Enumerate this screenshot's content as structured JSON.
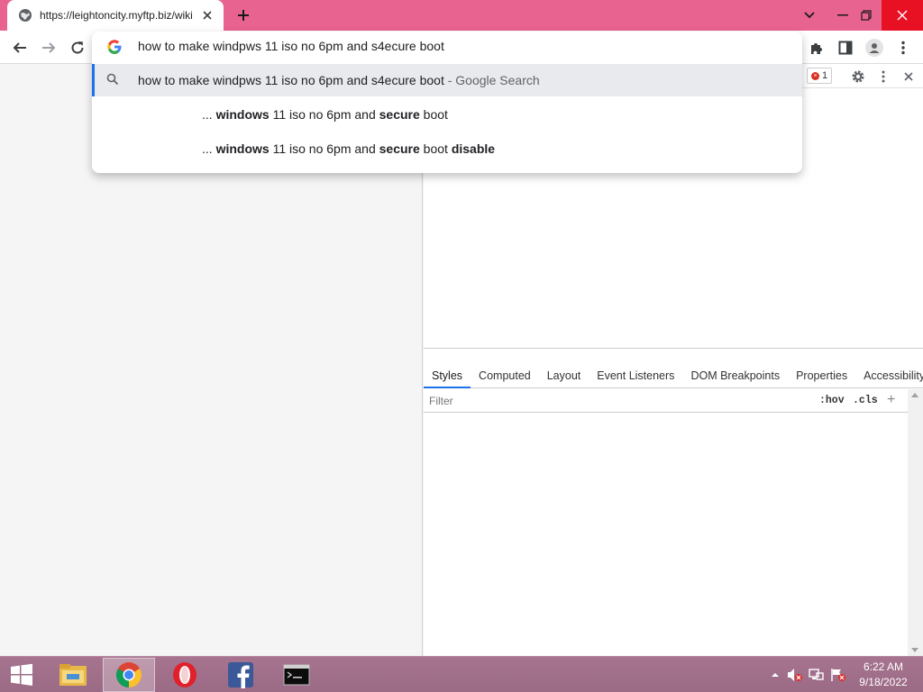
{
  "browser": {
    "tab": {
      "title": "https://leightoncity.myftp.biz/wiki",
      "favicon": "globe-icon",
      "close_icon": "close-icon"
    },
    "new_tab_icon": "plus-icon",
    "window_controls": [
      "chevron-down-icon",
      "minimize-icon",
      "restore-icon",
      "close-icon"
    ],
    "accent_color": "#e8638f",
    "nav": [
      "back-arrow-icon",
      "forward-arrow-icon",
      "reload-icon"
    ],
    "toolbar_right": [
      "extensions-icon",
      "side-panel-icon",
      "profile-icon",
      "menu-icon"
    ]
  },
  "omnibox": {
    "input_value": "how to make windpws 11 iso no 6pm and s4ecure boot",
    "suggestions": [
      {
        "text": "how to make windpws 11 iso no 6pm and s4ecure boot",
        "hint": "- Google Search",
        "icon": "search-icon"
      },
      {
        "prefix": "... ",
        "parts": [
          {
            "t": "windows",
            "b": true
          },
          {
            "t": " 11 iso no 6pm and ",
            "b": false
          },
          {
            "t": "secure",
            "b": true
          },
          {
            "t": " boot",
            "b": false
          }
        ]
      },
      {
        "prefix": "... ",
        "parts": [
          {
            "t": "windows",
            "b": true
          },
          {
            "t": " 11 iso no 6pm and ",
            "b": false
          },
          {
            "t": "secure",
            "b": true
          },
          {
            "t": " boot ",
            "b": false
          },
          {
            "t": "disable",
            "b": true
          }
        ]
      }
    ]
  },
  "devtools": {
    "error_count": "1",
    "tabs": [
      "Styles",
      "Computed",
      "Layout",
      "Event Listeners",
      "DOM Breakpoints",
      "Properties",
      "Accessibility"
    ],
    "active_tab": "Styles",
    "filter_placeholder": "Filter",
    "hov_label": ":hov",
    "cls_label": ".cls",
    "plus_label": "+"
  },
  "taskbar": {
    "apps": [
      "windows-start-icon",
      "file-explorer-icon",
      "chrome-icon",
      "opera-icon",
      "facebook-icon",
      "terminal-icon"
    ],
    "active_app": "chrome-icon",
    "tray": [
      "show-hidden-icons-icon",
      "volume-muted-icon",
      "network-icon",
      "flag-icon"
    ],
    "time": "6:22 AM",
    "date": "9/18/2022"
  }
}
